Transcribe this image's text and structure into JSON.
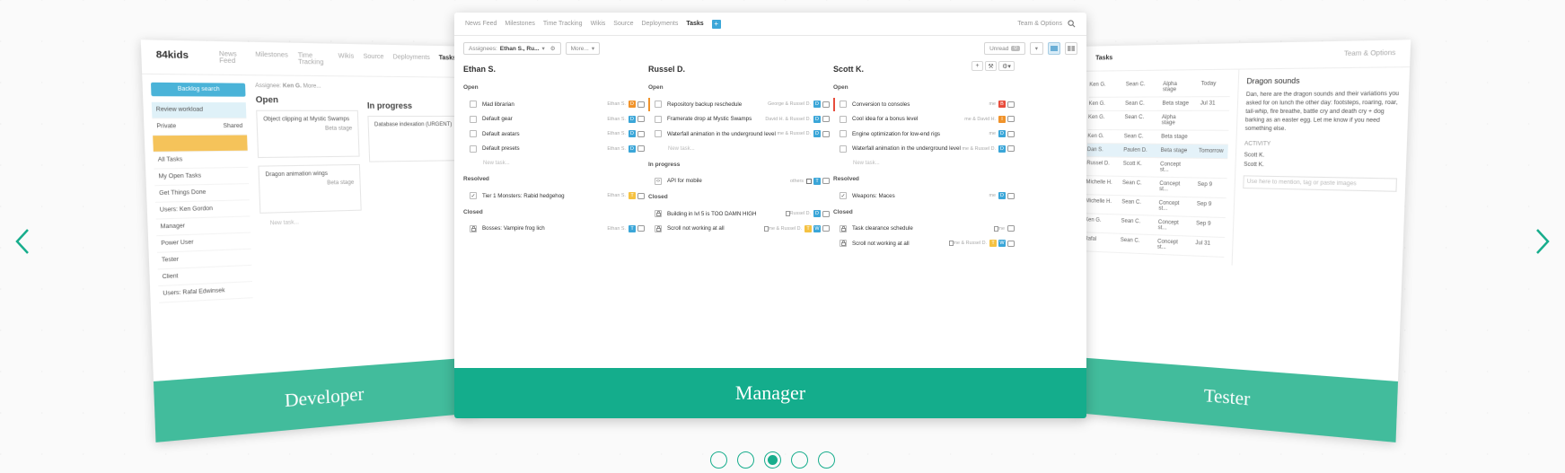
{
  "nav": {
    "left_arrow": "chevron-left",
    "right_arrow": "chevron-right",
    "accent": "#17ad8c"
  },
  "developer_card": {
    "footer_label": "Developer",
    "logo": "84kids",
    "nav_items": [
      "News Feed",
      "Milestones",
      "Time Tracking",
      "Wikis",
      "Source",
      "Deployments",
      "Tasks"
    ],
    "sidebar": [
      "Backlog search",
      "Review workload",
      "Private",
      "Shared",
      "All Tasks",
      "My Open Tasks",
      "Get Things Done",
      "Users: Ken Gordon",
      "Manager",
      "Power User",
      "Tester",
      "Client",
      "Users: Rafal Edwinsek"
    ],
    "filter_label": "Assignee:",
    "filter_value": "Ken G.",
    "more_label": "More...",
    "col_open": "Open",
    "col_inprogress": "In progress",
    "tasks": [
      "Object clipping at Mystic Swamps",
      "Dragon animation wings",
      "Database indexation (URGENT)"
    ],
    "milestone": "Beta stage",
    "new_task": "New task..."
  },
  "tester_card": {
    "footer_label": "Tester",
    "nav_label": "Tasks",
    "team_options": "Team & Options",
    "rows": [
      [
        "Ken G.",
        "Sean C.",
        "Alpha stage",
        "Today"
      ],
      [
        "Ken G.",
        "Sean C.",
        "Beta stage",
        "Jul 31"
      ],
      [
        "Ken G.",
        "Sean C.",
        "Alpha stage",
        ""
      ],
      [
        "Ken G.",
        "Sean C.",
        "Beta stage",
        ""
      ],
      [
        "Dan S.",
        "Paulen D.",
        "Beta stage",
        "Tomorrow"
      ],
      [
        "Russel D.",
        "Scott K.",
        "Concept st...",
        ""
      ],
      [
        "Michelle H.",
        "Sean C.",
        "Concept st...",
        "Sep 9"
      ],
      [
        "Michelle H.",
        "Sean C.",
        "Concept st...",
        "Sep 9"
      ],
      [
        "Ken G.",
        "Sean C.",
        "Concept st...",
        "Sep 9"
      ],
      [
        "Rafal",
        "Sean C.",
        "Concept st...",
        "Jul 31"
      ]
    ],
    "detail_title": "Dragon sounds",
    "detail_text": "Dan, here are the dragon sounds and their variations you asked for on lunch the other day: footsteps, roaring, roar, tail-whip, fire breathe, battle cry and death cry + dog barking as an easter egg. Let me know if you need something else.",
    "activity": "ACTIVITY",
    "comment_author_1": "Scott K.",
    "comment_author_2": "Scott K.",
    "reply_placeholder": "Use here to mention, tag or paste images"
  },
  "manager_card": {
    "footer_label": "Manager",
    "nav_items": [
      "News Feed",
      "Milestones",
      "Time Tracking",
      "Wikis",
      "Source",
      "Deployments",
      "Tasks"
    ],
    "add_label": "+",
    "team_options": "Team & Options",
    "assignees_label": "Assignees:",
    "assignees_value": "Ethan S., Ru...",
    "more_label": "More...",
    "unread_label": "Unread",
    "unread_count": "0",
    "columns": [
      {
        "name": "Ethan S.",
        "sections": [
          {
            "label": "Open",
            "tasks": [
              {
                "title": "Mad librarian",
                "assignee": "Ethan S.",
                "tag": "D",
                "tag_color": "#f0932b",
                "bar": ""
              },
              {
                "title": "Default gear",
                "assignee": "Ethan S.",
                "tag": "D",
                "tag_color": "#3ba6d8",
                "bar": ""
              },
              {
                "title": "Default avatars",
                "assignee": "Ethan S.",
                "tag": "D",
                "tag_color": "#3ba6d8",
                "bar": ""
              },
              {
                "title": "Default presets",
                "assignee": "Ethan S.",
                "tag": "D",
                "tag_color": "#3ba6d8",
                "bar": ""
              }
            ],
            "new_task": "New task..."
          },
          {
            "label": "Resolved",
            "tasks": [
              {
                "title": "Tier 1 Monsters: Rabid hedgehog",
                "assignee": "Ethan S.",
                "tag": "T",
                "tag_color": "#f5c242",
                "bar": "",
                "checked": true
              }
            ]
          },
          {
            "label": "Closed",
            "tasks": [
              {
                "title": "Bosses: Vampire frog lich",
                "assignee": "Ethan S.",
                "tag": "T",
                "tag_color": "#3ba6d8",
                "bar": "",
                "locked": true
              }
            ]
          }
        ]
      },
      {
        "name": "Russel D.",
        "sections": [
          {
            "label": "Open",
            "tasks": [
              {
                "title": "Repository backup reschedule",
                "assignee": "George & Russel D.",
                "tag": "D",
                "tag_color": "#3ba6d8",
                "bar": "#f0932b"
              },
              {
                "title": "Framerate drop at Mystic Swamps",
                "assignee": "David H. & Russel D.",
                "tag": "D",
                "tag_color": "#3ba6d8",
                "bar": ""
              },
              {
                "title": "Waterfall animation in the underground level",
                "assignee": "me & Russel D.",
                "tag": "D",
                "tag_color": "#3ba6d8",
                "bar": ""
              }
            ],
            "new_task": "New task..."
          },
          {
            "label": "In progress",
            "tasks": [
              {
                "title": "API for mobile",
                "assignee": "others",
                "tag": "T",
                "tag_color": "#3ba6d8",
                "bar": "",
                "code": true
              }
            ]
          },
          {
            "label": "Closed",
            "tasks": [
              {
                "title": "Building in lvl 5 is TOO DAMN HIGH",
                "assignee": "Russel D.",
                "tag": "D",
                "tag_color": "#3ba6d8",
                "bar": "",
                "locked": true,
                "doc": true
              },
              {
                "title": "Scroll not working at all",
                "assignee": "me & Russel D.",
                "tag": "T",
                "tag_color": "#f5c242",
                "tag2": "W",
                "tag2_color": "#3ba6d8",
                "bar": "",
                "locked": true,
                "doc": true
              }
            ]
          }
        ]
      },
      {
        "name": "Scott K.",
        "sections": [
          {
            "label": "Open",
            "tasks": [
              {
                "title": "Conversion to consoles",
                "assignee": "me",
                "tag": "B",
                "tag_color": "#e74c3c",
                "bar": "#e74c3c"
              },
              {
                "title": "Cool idea for a bonus level",
                "assignee": "me & David H.",
                "tag": "I",
                "tag_color": "#f0932b",
                "bar": ""
              },
              {
                "title": "Engine optimization for low-end rigs",
                "assignee": "me",
                "tag": "D",
                "tag_color": "#3ba6d8",
                "bar": ""
              },
              {
                "title": "Waterfall animation in the underground level",
                "assignee": "me & Russel D.",
                "tag": "D",
                "tag_color": "#3ba6d8",
                "bar": ""
              }
            ],
            "new_task": "New task..."
          },
          {
            "label": "Resolved",
            "tasks": [
              {
                "title": "Weapons: Maces",
                "assignee": "me",
                "tag": "D",
                "tag_color": "#3ba6d8",
                "bar": "",
                "checked": true
              }
            ]
          },
          {
            "label": "Closed",
            "tasks": [
              {
                "title": "Task clearance schedule",
                "assignee": "me",
                "tag": "",
                "tag_color": "",
                "bar": "",
                "locked": true,
                "doc": true
              },
              {
                "title": "Scroll not working at all",
                "assignee": "me & Russel D.",
                "tag": "T",
                "tag_color": "#f5c242",
                "tag2": "W",
                "tag2_color": "#3ba6d8",
                "bar": "",
                "locked": true,
                "doc": true
              }
            ]
          }
        ]
      }
    ]
  },
  "pagination": {
    "count": 5,
    "active_index": 2
  }
}
